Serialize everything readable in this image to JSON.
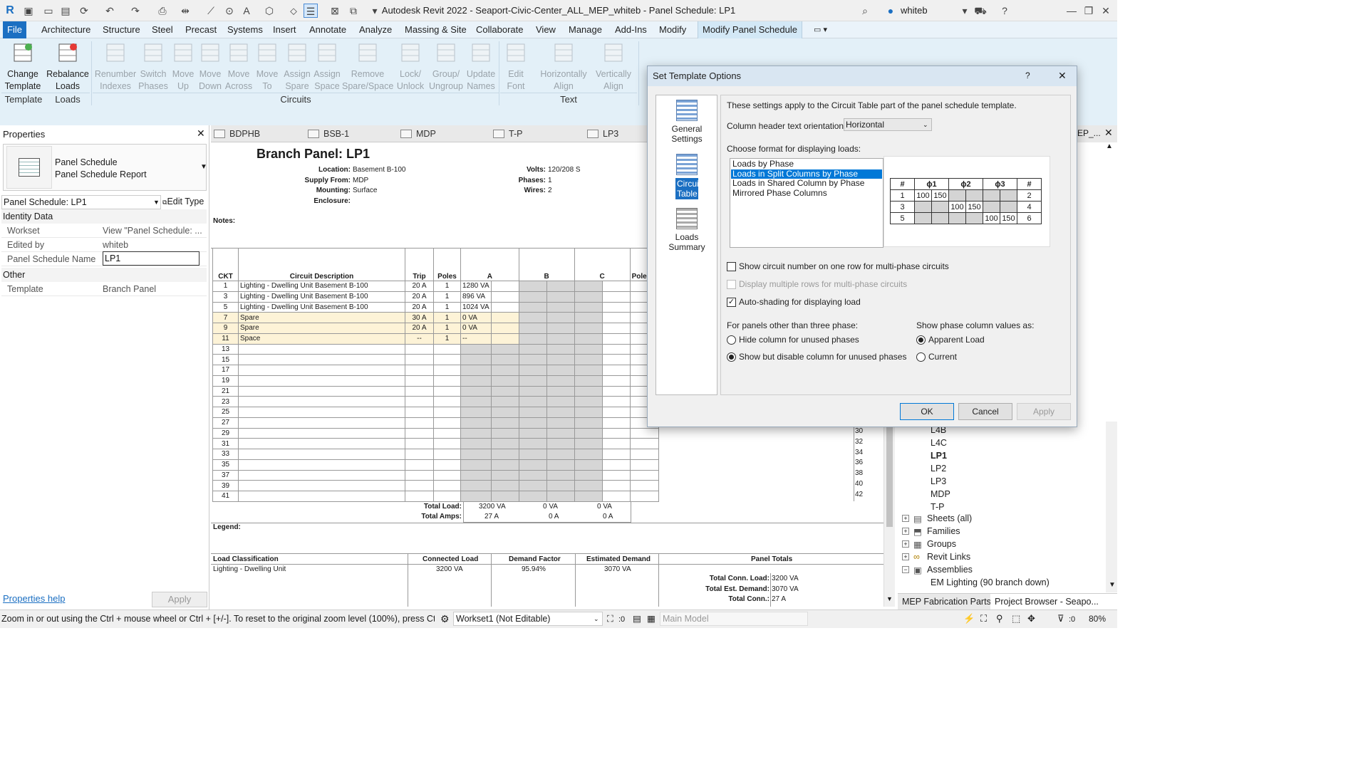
{
  "app": {
    "title": "Autodesk Revit 2022 - Seaport-Civic-Center_ALL_MEP_whiteb - Panel Schedule: LP1",
    "user": "whiteb"
  },
  "menu": [
    "File",
    "Architecture",
    "Structure",
    "Steel",
    "Precast",
    "Systems",
    "Insert",
    "Annotate",
    "Analyze",
    "Massing & Site",
    "Collaborate",
    "View",
    "Manage",
    "Add-Ins",
    "Modify",
    "Modify Panel Schedule"
  ],
  "ribbon": {
    "buttons": [
      [
        "Change",
        "Template"
      ],
      [
        "Rebalance",
        "Loads"
      ],
      [
        "Renumber",
        "Indexes"
      ],
      [
        "Switch",
        "Phases"
      ],
      [
        "Move",
        "Up"
      ],
      [
        "Move",
        "Down"
      ],
      [
        "Move",
        "Across"
      ],
      [
        "Move",
        "To"
      ],
      [
        "Assign",
        "Spare"
      ],
      [
        "Assign",
        "Space"
      ],
      [
        "Remove",
        "Spare/Space"
      ],
      [
        "Lock/",
        "Unlock"
      ],
      [
        "Group/",
        "Ungroup"
      ],
      [
        "Update",
        "Names"
      ],
      [
        "Edit",
        "Font"
      ],
      [
        "Horizontally",
        "Align"
      ],
      [
        "Vertically",
        "Align"
      ]
    ],
    "groups": [
      "Template",
      "Loads",
      "Circuits",
      "Text"
    ]
  },
  "properties": {
    "title": "Properties",
    "type_line1": "Panel Schedule",
    "type_line2": "Panel Schedule Report",
    "selector": "Panel Schedule: LP1",
    "edit_type": "Edit Type",
    "section1": "Identity Data",
    "section2": "Other",
    "rows": [
      {
        "k": "Workset",
        "v": "View \"Panel Schedule: ..."
      },
      {
        "k": "Edited by",
        "v": "whiteb"
      },
      {
        "k": "Panel Schedule Name",
        "v": "LP1"
      }
    ],
    "other_rows": [
      {
        "k": "Template",
        "v": "Branch Panel"
      }
    ],
    "help": "Properties help",
    "apply": "Apply"
  },
  "tabs": [
    "BDPHB",
    "BSB-1",
    "MDP",
    "T-P",
    "LP3",
    "EP_..."
  ],
  "schedule": {
    "title": "Branch Panel: LP1",
    "info_left": [
      [
        "Location:",
        "Basement B-100"
      ],
      [
        "Supply From:",
        "MDP"
      ],
      [
        "Mounting:",
        "Surface"
      ],
      [
        "Enclosure:",
        ""
      ]
    ],
    "info_right": [
      [
        "Volts:",
        "120/208 S"
      ],
      [
        "Phases:",
        "1"
      ],
      [
        "Wires:",
        "2"
      ]
    ],
    "notes": "Notes:",
    "headers": [
      "CKT",
      "Circuit Description",
      "Trip",
      "Poles",
      "A",
      "B",
      "C",
      "Pole"
    ],
    "rows": [
      [
        "1",
        "Lighting - Dwelling Unit Basement B-100",
        "20 A",
        "1",
        "1280 VA"
      ],
      [
        "3",
        "Lighting - Dwelling Unit Basement B-100",
        "20 A",
        "1",
        "896 VA"
      ],
      [
        "5",
        "Lighting - Dwelling Unit Basement B-100",
        "20 A",
        "1",
        "1024 VA"
      ],
      [
        "7",
        "Spare",
        "30 A",
        "1",
        "0 VA"
      ],
      [
        "9",
        "Spare",
        "20 A",
        "1",
        "0 VA"
      ],
      [
        "11",
        "Space",
        "--",
        "1",
        "--"
      ],
      [
        "13",
        "",
        "",
        "",
        ""
      ],
      [
        "15",
        "",
        "",
        "",
        ""
      ],
      [
        "17",
        "",
        "",
        "",
        ""
      ],
      [
        "19",
        "",
        "",
        "",
        ""
      ],
      [
        "21",
        "",
        "",
        "",
        ""
      ],
      [
        "23",
        "",
        "",
        "",
        ""
      ],
      [
        "25",
        "",
        "",
        "",
        ""
      ],
      [
        "27",
        "",
        "",
        "",
        ""
      ],
      [
        "29",
        "",
        "",
        "",
        ""
      ],
      [
        "31",
        "",
        "",
        "",
        ""
      ],
      [
        "33",
        "",
        "",
        "",
        ""
      ],
      [
        "35",
        "",
        "",
        "",
        ""
      ],
      [
        "37",
        "",
        "",
        "",
        ""
      ],
      [
        "39",
        "",
        "",
        "",
        ""
      ],
      [
        "41",
        "",
        "",
        "",
        ""
      ]
    ],
    "right_ckts": [
      "30",
      "32",
      "34",
      "36",
      "38",
      "40",
      "42"
    ],
    "total_load_label": "Total Load:",
    "total_amps_label": "Total Amps:",
    "total_load": [
      "3200 VA",
      "0 VA",
      "0 VA"
    ],
    "total_amps": [
      "27 A",
      "0 A",
      "0 A"
    ],
    "legend": "Legend:",
    "summary_headers": [
      "Load Classification",
      "Connected Load",
      "Demand Factor",
      "Estimated Demand",
      "Panel Totals"
    ],
    "summary_row": [
      "Lighting - Dwelling Unit",
      "3200 VA",
      "95.94%",
      "3070 VA"
    ],
    "totals": [
      [
        "Total Conn. Load:",
        "3200 VA"
      ],
      [
        "Total Est. Demand:",
        "3070 VA"
      ],
      [
        "Total Conn.:",
        "27 A"
      ]
    ]
  },
  "dialog": {
    "title": "Set Template Options",
    "help": "?",
    "side": [
      "General Settings",
      "Circuit Table",
      "Loads Summary"
    ],
    "intro": "These settings apply to the Circuit Table part of the panel schedule template.",
    "orientation_label": "Column header text orientation:",
    "orientation_value": "Horizontal",
    "format_label": "Choose format for displaying loads:",
    "formats": [
      "Loads by Phase",
      "Loads in Split Columns by Phase",
      "Loads in Shared Column by Phase",
      "Mirrored Phase Columns"
    ],
    "preview_header": [
      "#",
      "ϕ1",
      "",
      "ϕ2",
      "",
      "ϕ3",
      "",
      "#"
    ],
    "preview_rows": [
      [
        "1",
        "100",
        "150",
        "",
        "",
        "",
        "",
        "2"
      ],
      [
        "3",
        "",
        "",
        "100",
        "150",
        "",
        "",
        "4"
      ],
      [
        "5",
        "",
        "",
        "",
        "",
        "100",
        "150",
        "6"
      ]
    ],
    "cb1": "Show circuit number on one row for multi-phase circuits",
    "cb2": "Display multiple rows for multi-phase circuits",
    "cb3": "Auto-shading for displaying load",
    "panels_label": "For panels other than three phase:",
    "r1": "Hide column for unused phases",
    "r2": "Show but disable column for unused phases",
    "show_label": "Show phase column values as:",
    "r3": "Apparent Load",
    "r4": "Current",
    "ok": "OK",
    "cancel": "Cancel",
    "apply": "Apply"
  },
  "browser": {
    "items": [
      "L4B",
      "L4C",
      "LP1",
      "LP2",
      "LP3",
      "MDP",
      "T-P"
    ],
    "groups": [
      "Sheets (all)",
      "Families",
      "Groups",
      "Revit Links",
      "Assemblies"
    ],
    "assembly_item": "EM Lighting (90 branch down)",
    "tab1": "MEP Fabrication Parts",
    "tab2": "Project Browser - Seapo..."
  },
  "status": {
    "text": "Zoom in or out using the Ctrl + mouse wheel or Ctrl + [+/-]. To reset to the original zoom level (100%), press Ctrl",
    "workset": "Workset1 (Not Editable)",
    "model": "Main Model",
    "zero": ":0",
    "zoom": "80%"
  }
}
